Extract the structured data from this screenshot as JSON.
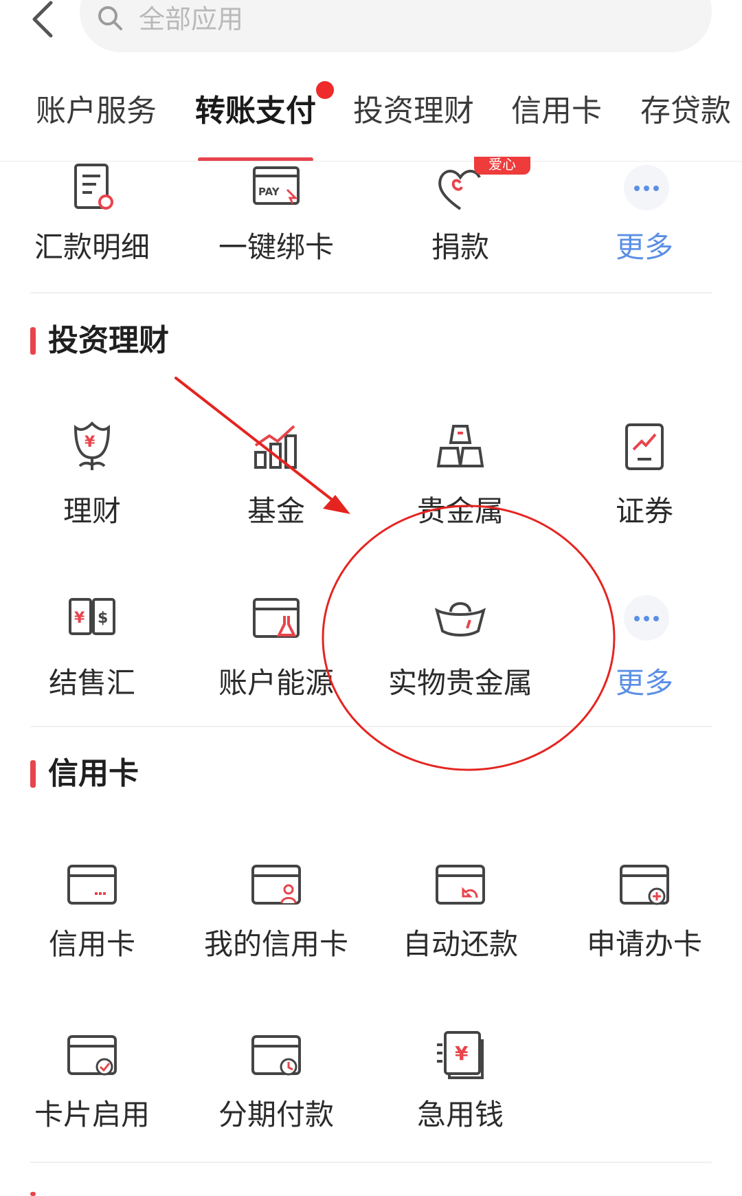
{
  "search": {
    "placeholder": "全部应用"
  },
  "tabs": [
    {
      "label": "账户服务",
      "active": false
    },
    {
      "label": "转账支付",
      "active": true
    },
    {
      "label": "投资理财",
      "active": false
    },
    {
      "label": "信用卡",
      "active": false
    },
    {
      "label": "存贷款",
      "active": false
    }
  ],
  "transfer_row": {
    "items": [
      {
        "label": "汇款明细",
        "icon": "receipt-icon"
      },
      {
        "label": "一键绑卡",
        "icon": "pay-card-icon"
      },
      {
        "label": "捐款",
        "icon": "heart-donation-icon",
        "badge": "爱心"
      },
      {
        "label": "更多",
        "icon": "more-icon"
      }
    ]
  },
  "investment": {
    "title": "投资理财",
    "items": [
      {
        "label": "理财",
        "icon": "flower-yen-icon"
      },
      {
        "label": "基金",
        "icon": "fund-chart-icon"
      },
      {
        "label": "贵金属",
        "icon": "gold-bars-icon"
      },
      {
        "label": "证券",
        "icon": "securities-icon"
      },
      {
        "label": "结售汇",
        "icon": "currency-exchange-icon"
      },
      {
        "label": "账户能源",
        "icon": "energy-account-icon"
      },
      {
        "label": "实物贵金属",
        "icon": "gold-ingot-icon"
      },
      {
        "label": "更多",
        "icon": "more-icon"
      }
    ]
  },
  "credit": {
    "title": "信用卡",
    "items": [
      {
        "label": "信用卡",
        "icon": "credit-card-icon"
      },
      {
        "label": "我的信用卡",
        "icon": "my-card-icon"
      },
      {
        "label": "自动还款",
        "icon": "auto-repay-icon"
      },
      {
        "label": "申请办卡",
        "icon": "apply-card-icon"
      },
      {
        "label": "卡片启用",
        "icon": "card-activate-icon"
      },
      {
        "label": "分期付款",
        "icon": "installment-icon"
      },
      {
        "label": "急用钱",
        "icon": "quick-cash-icon"
      }
    ]
  },
  "colors": {
    "accent": "#e8444c",
    "link": "#5b8fe6",
    "annotation": "#e52420"
  }
}
